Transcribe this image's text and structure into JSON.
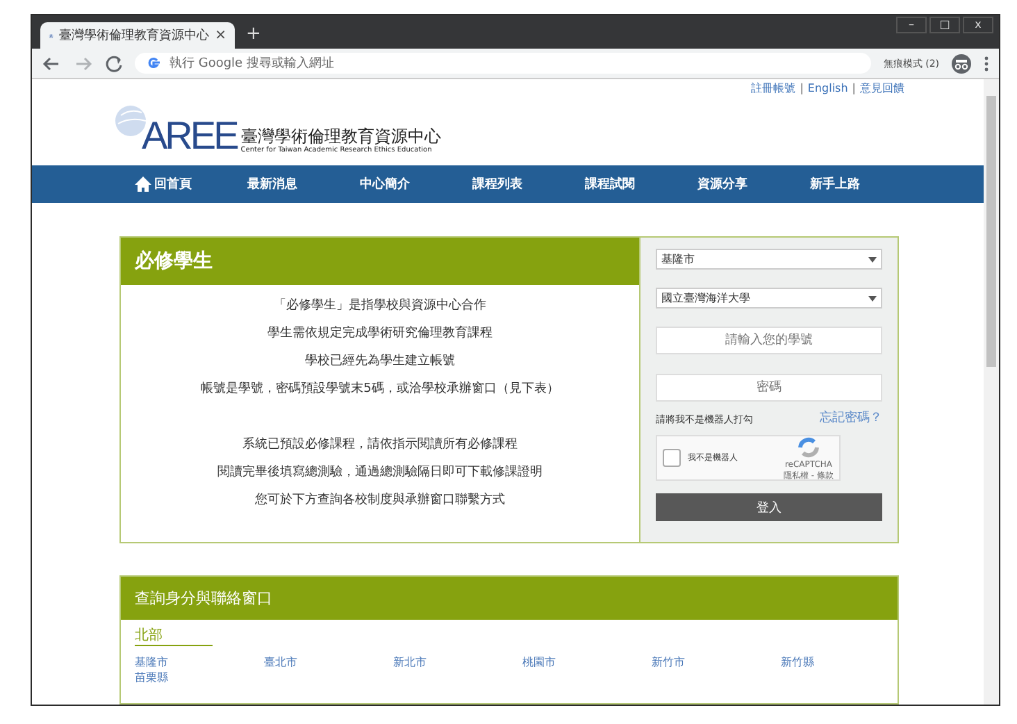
{
  "browser": {
    "tab_title": "臺灣學術倫理教育資源中心",
    "tab_close": "×",
    "new_tab": "+",
    "window_controls": [
      "–",
      "□",
      "x"
    ],
    "address_placeholder": "執行 Google 搜尋或輸入網址",
    "incognito_label": "無痕模式 (2)"
  },
  "top_links": [
    "註冊帳號",
    "English",
    "意見回饋"
  ],
  "top_link_separator": "|",
  "logo": {
    "mark": "AREE",
    "title": "臺灣學術倫理教育資源中心",
    "subtitle": "Center for Taiwan Academic Research Ethics Education"
  },
  "nav": [
    {
      "label": "回首頁",
      "kind": "home"
    },
    {
      "label": "最新消息"
    },
    {
      "label": "中心簡介"
    },
    {
      "label": "課程列表"
    },
    {
      "label": "課程試閱"
    },
    {
      "label": "資源分享"
    },
    {
      "label": "新手上路"
    }
  ],
  "intro": {
    "title": "必修學生",
    "paragraphs": [
      [
        "「必修學生」是指學校與資源中心合作",
        "學生需依規定完成學術研究倫理教育課程",
        "學校已經先為學生建立帳號",
        "帳號是學號，密碼預設學號末5碼，或洽學校承辦窗口（見下表）"
      ],
      [
        "系統已預設必修課程，請依指示閱讀所有必修課程",
        "閱讀完畢後填寫總測驗，通過總測驗隔日即可下載修課證明",
        "您可於下方查詢各校制度與承辦窗口聯繫方式"
      ]
    ]
  },
  "login": {
    "city": "基隆市",
    "school": "國立臺灣海洋大學",
    "student_id_placeholder": "請輸入您的學號",
    "password_placeholder": "密碼",
    "forgot": "忘記密碼？",
    "captcha_prompt": "請將我不是機器人打勾",
    "captcha": {
      "label": "我不是機器人",
      "checked": false,
      "brand": "reCAPTCHA",
      "terms": "隱私權 - 條款"
    },
    "submit": "登入"
  },
  "contacts": {
    "title": "查詢身分與聯絡窗口",
    "region": "北部",
    "cities": [
      "基隆市",
      "臺北市",
      "新北市",
      "桃園市",
      "新竹市",
      "新竹縣",
      "苗栗縣"
    ]
  }
}
